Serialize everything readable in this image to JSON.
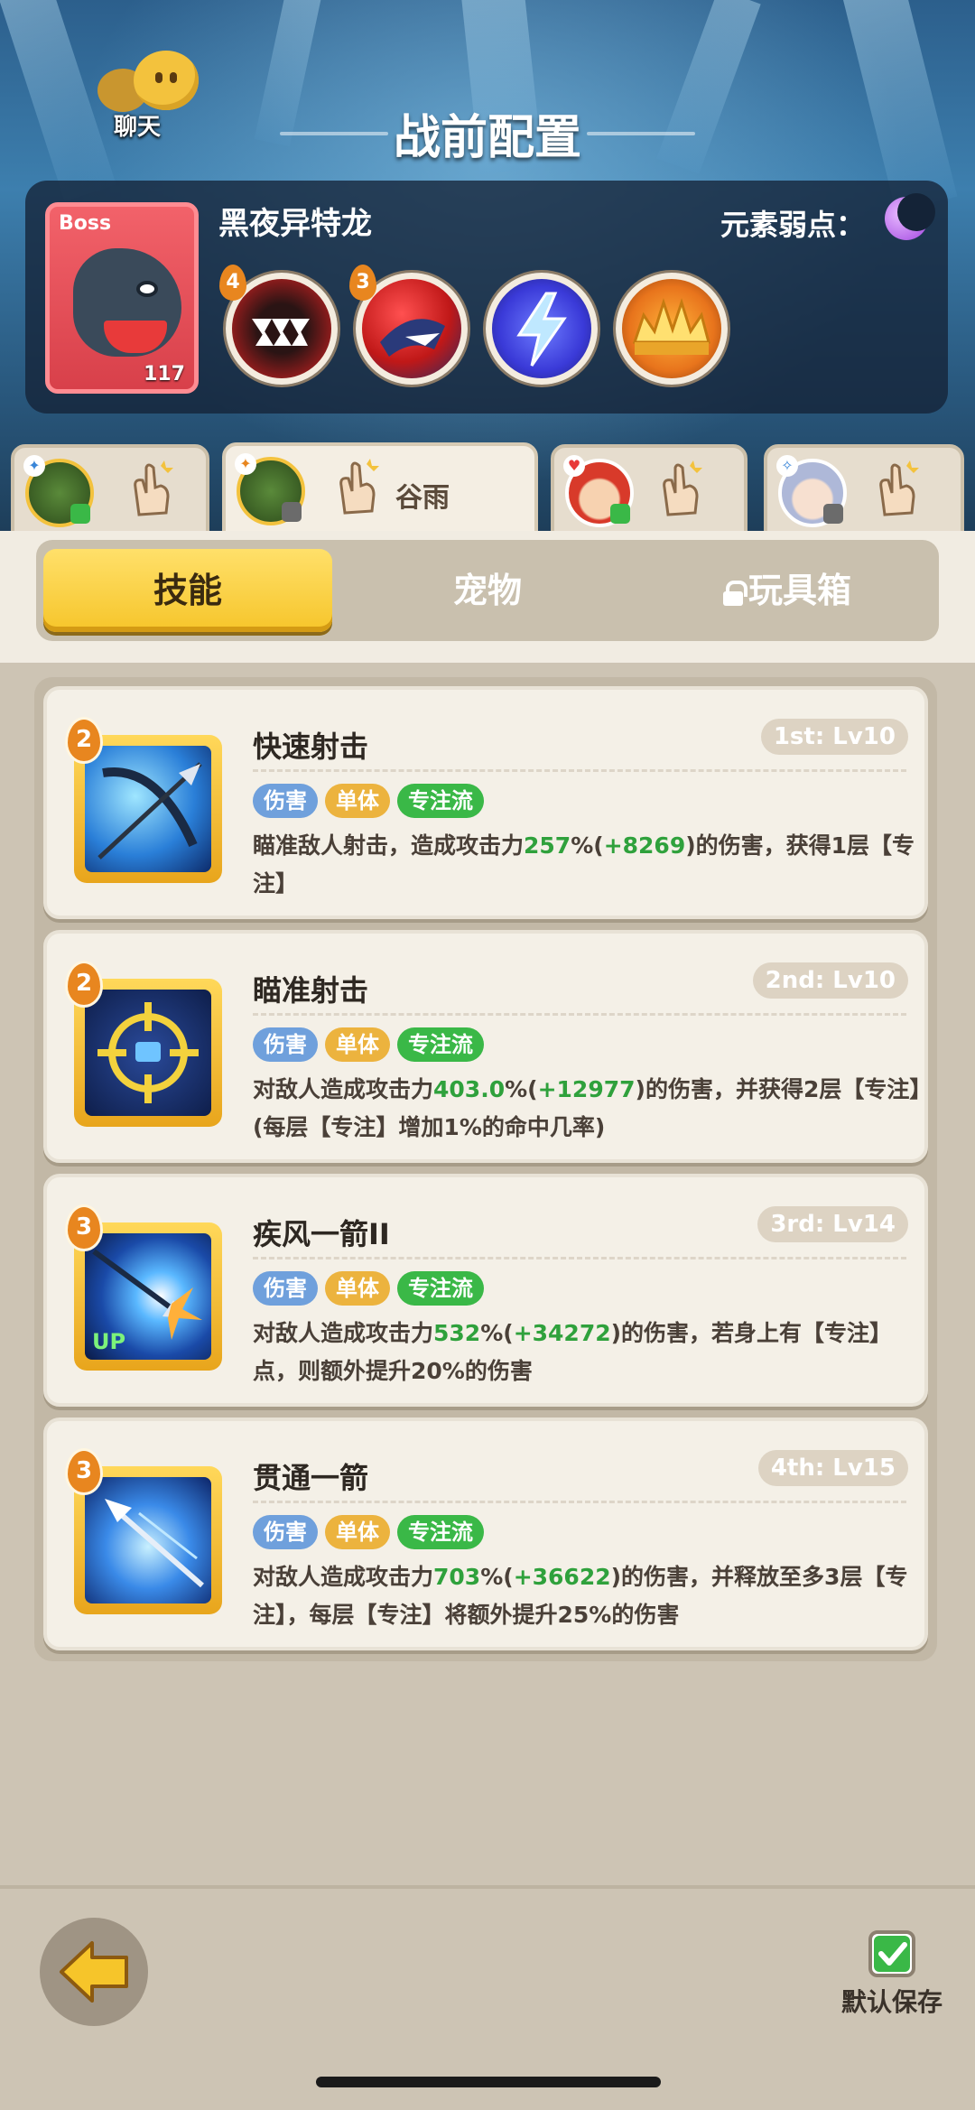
{
  "header": {
    "chat_label": "聊天",
    "title": "战前配置"
  },
  "boss": {
    "tag": "Boss",
    "level": "117",
    "name": "黑夜异特龙",
    "weakness_label": "元素弱点：",
    "weakness_icon": "moon-icon",
    "skills": [
      {
        "badge": "4",
        "icon": "fang-maw-icon"
      },
      {
        "badge": "3",
        "icon": "red-beast-icon"
      },
      {
        "badge": "",
        "icon": "lightning-icon"
      },
      {
        "badge": "",
        "icon": "crown-spikes-icon"
      }
    ]
  },
  "heroes": [
    {
      "name": "",
      "active": false
    },
    {
      "name": "谷雨",
      "active": true
    },
    {
      "name": "",
      "active": false
    },
    {
      "name": "",
      "active": false
    }
  ],
  "segments": {
    "skills": "技能",
    "pets": "宠物",
    "toybox": "玩具箱"
  },
  "skills": [
    {
      "badge": "2",
      "name": "快速射击",
      "level": "1st: Lv10",
      "tags": [
        "伤害",
        "单体",
        "专注流"
      ],
      "desc_a": "瞄准敌人射击，造成攻击力",
      "pct": "257",
      "desc_b": "%(",
      "bonus": "+8269",
      "desc_c": ")的伤害，获得1层【专注】"
    },
    {
      "badge": "2",
      "name": "瞄准射击",
      "level": "2nd: Lv10",
      "tags": [
        "伤害",
        "单体",
        "专注流"
      ],
      "desc_a": "对敌人造成攻击力",
      "pct": "403.0",
      "desc_b": "%(",
      "bonus": "+12977",
      "desc_c": ")的伤害，并获得2层【专注】(每层【专注】增加1%的命中几率)"
    },
    {
      "badge": "3",
      "name": "疾风一箭II",
      "level": "3rd: Lv14",
      "tags": [
        "伤害",
        "单体",
        "专注流"
      ],
      "desc_a": "对敌人造成攻击力",
      "pct": "532",
      "desc_b": "%(",
      "bonus": "+34272",
      "desc_c": ")的伤害，若身上有【专注】点，则额外提升20%的伤害",
      "icon_text": "UP"
    },
    {
      "badge": "3",
      "name": "贯通一箭",
      "level": "4th: Lv15",
      "tags": [
        "伤害",
        "单体",
        "专注流"
      ],
      "desc_a": "对敌人造成攻击力",
      "pct": "703",
      "desc_b": "%(",
      "bonus": "+36622",
      "desc_c": ")的伤害，并释放至多3层【专注】，每层【专注】将额外提升25%的伤害"
    }
  ],
  "footer": {
    "save_label": "默认保存"
  }
}
